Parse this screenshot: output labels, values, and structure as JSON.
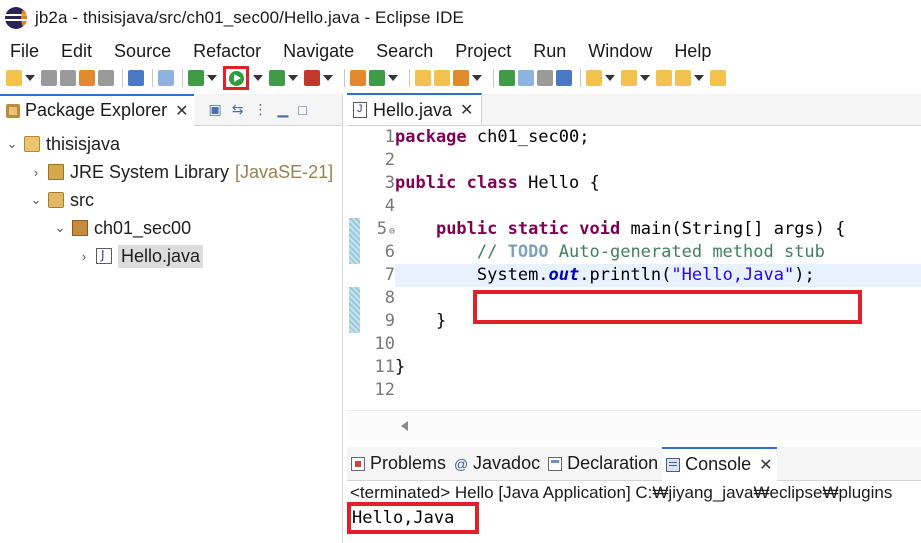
{
  "window": {
    "title": "jb2a - thisisjava/src/ch01_sec00/Hello.java - Eclipse IDE"
  },
  "menu": [
    "File",
    "Edit",
    "Source",
    "Refactor",
    "Navigate",
    "Search",
    "Project",
    "Run",
    "Window",
    "Help"
  ],
  "package_explorer": {
    "tab_label": "Package Explorer",
    "close_glyph": "✕",
    "tree": {
      "project": "thisisjava",
      "library": "JRE System Library",
      "library_version": "[JavaSE-21]",
      "src_folder": "src",
      "package": "ch01_sec00",
      "file": "Hello.java"
    }
  },
  "editor": {
    "tab_label": "Hello.java",
    "close_glyph": "✕",
    "line_numbers": [
      "1",
      "2",
      "3",
      "4",
      "5",
      "6",
      "7",
      "8",
      "9",
      "10",
      "11",
      "12"
    ],
    "code": {
      "l1_kw": "package",
      "l1_rest": " ch01_sec00;",
      "l3_kw1": "public",
      "l3_kw2": "class",
      "l3_rest": " Hello {",
      "l5_indent": "    ",
      "l5_kw1": "public",
      "l5_kw2": "static",
      "l5_kw3": "void",
      "l5_rest": " main(String[] args) {",
      "l6_indent": "        ",
      "l6_c1": "// ",
      "l6_todo": "TODO",
      "l6_c2": " Auto-generated method stub",
      "l7_indent": "        ",
      "l7_a": "System.",
      "l7_field": "out",
      "l7_b": ".println(",
      "l7_str": "\"Hello,Java\"",
      "l7_c": ");",
      "l9_text": "    }",
      "l11_text": "}"
    }
  },
  "bottom_panel": {
    "tabs": [
      "Problems",
      "Javadoc",
      "Declaration",
      "Console"
    ],
    "active_tab": "Console",
    "close_glyph": "✕",
    "status": "<terminated> Hello [Java Application] C:₩jiyang_java₩eclipse₩plugins",
    "output": "Hello,Java"
  },
  "highlight_color": "#e3202a"
}
